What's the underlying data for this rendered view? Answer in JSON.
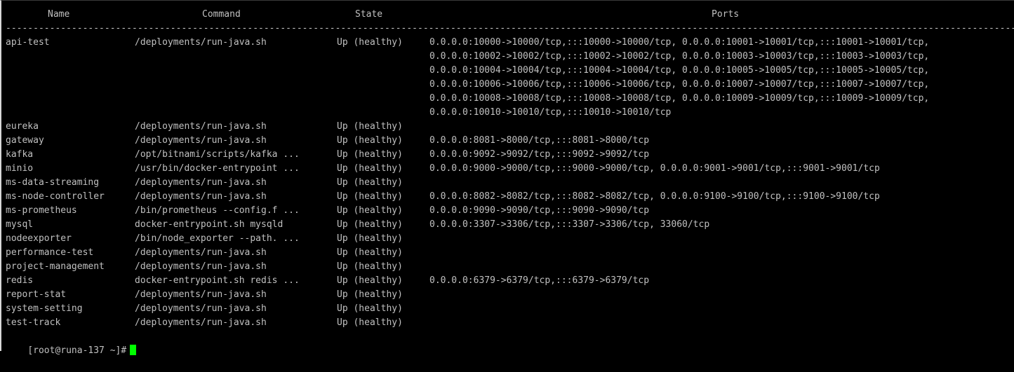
{
  "header": {
    "name": "Name",
    "command": "Command",
    "state": "State",
    "ports": "Ports"
  },
  "separator": "---------------------------------------------------------------------------------------------------------------------------------------------------------------------------------------------------------------------------------------",
  "rows": [
    {
      "name": "api-test",
      "command": "/deployments/run-java.sh",
      "state": "Up (healthy)",
      "ports": [
        "0.0.0.0:10000->10000/tcp,:::10000->10000/tcp, 0.0.0.0:10001->10001/tcp,:::10001->10001/tcp,",
        "0.0.0.0:10002->10002/tcp,:::10002->10002/tcp, 0.0.0.0:10003->10003/tcp,:::10003->10003/tcp,",
        "0.0.0.0:10004->10004/tcp,:::10004->10004/tcp, 0.0.0.0:10005->10005/tcp,:::10005->10005/tcp,",
        "0.0.0.0:10006->10006/tcp,:::10006->10006/tcp, 0.0.0.0:10007->10007/tcp,:::10007->10007/tcp,",
        "0.0.0.0:10008->10008/tcp,:::10008->10008/tcp, 0.0.0.0:10009->10009/tcp,:::10009->10009/tcp,",
        "0.0.0.0:10010->10010/tcp,:::10010->10010/tcp"
      ]
    },
    {
      "name": "eureka",
      "command": "/deployments/run-java.sh",
      "state": "Up (healthy)",
      "ports": [
        ""
      ]
    },
    {
      "name": "gateway",
      "command": "/deployments/run-java.sh",
      "state": "Up (healthy)",
      "ports": [
        "0.0.0.0:8081->8000/tcp,:::8081->8000/tcp"
      ]
    },
    {
      "name": "kafka",
      "command": "/opt/bitnami/scripts/kafka ...",
      "state": "Up (healthy)",
      "ports": [
        "0.0.0.0:9092->9092/tcp,:::9092->9092/tcp"
      ]
    },
    {
      "name": "minio",
      "command": "/usr/bin/docker-entrypoint ...",
      "state": "Up (healthy)",
      "ports": [
        "0.0.0.0:9000->9000/tcp,:::9000->9000/tcp, 0.0.0.0:9001->9001/tcp,:::9001->9001/tcp"
      ]
    },
    {
      "name": "ms-data-streaming",
      "command": "/deployments/run-java.sh",
      "state": "Up (healthy)",
      "ports": [
        ""
      ]
    },
    {
      "name": "ms-node-controller",
      "command": "/deployments/run-java.sh",
      "state": "Up (healthy)",
      "ports": [
        "0.0.0.0:8082->8082/tcp,:::8082->8082/tcp, 0.0.0.0:9100->9100/tcp,:::9100->9100/tcp"
      ]
    },
    {
      "name": "ms-prometheus",
      "command": "/bin/prometheus --config.f ...",
      "state": "Up (healthy)",
      "ports": [
        "0.0.0.0:9090->9090/tcp,:::9090->9090/tcp"
      ]
    },
    {
      "name": "mysql",
      "command": "docker-entrypoint.sh mysqld",
      "state": "Up (healthy)",
      "ports": [
        "0.0.0.0:3307->3306/tcp,:::3307->3306/tcp, 33060/tcp"
      ]
    },
    {
      "name": "nodeexporter",
      "command": "/bin/node_exporter --path. ...",
      "state": "Up (healthy)",
      "ports": [
        ""
      ]
    },
    {
      "name": "performance-test",
      "command": "/deployments/run-java.sh",
      "state": "Up (healthy)",
      "ports": [
        ""
      ]
    },
    {
      "name": "project-management",
      "command": "/deployments/run-java.sh",
      "state": "Up (healthy)",
      "ports": [
        ""
      ]
    },
    {
      "name": "redis",
      "command": "docker-entrypoint.sh redis ...",
      "state": "Up (healthy)",
      "ports": [
        "0.0.0.0:6379->6379/tcp,:::6379->6379/tcp"
      ]
    },
    {
      "name": "report-stat",
      "command": "/deployments/run-java.sh",
      "state": "Up (healthy)",
      "ports": [
        ""
      ]
    },
    {
      "name": "system-setting",
      "command": "/deployments/run-java.sh",
      "state": "Up (healthy)",
      "ports": [
        ""
      ]
    },
    {
      "name": "test-track",
      "command": "/deployments/run-java.sh",
      "state": "Up (healthy)",
      "ports": [
        ""
      ]
    }
  ],
  "prompt": "[root@runa-137 ~]#",
  "colors": {
    "background": "#000000",
    "text": "#c0c0c0",
    "cursor": "#00ff00"
  }
}
